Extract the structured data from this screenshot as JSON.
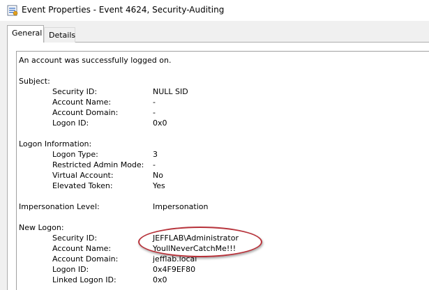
{
  "window": {
    "title": "Event Properties - Event 4624, Security-Auditing"
  },
  "tabs": [
    {
      "label": "General",
      "active": true
    },
    {
      "label": "Details",
      "active": false
    }
  ],
  "event": {
    "summary": "An account was successfully logged on.",
    "subject": {
      "heading": "Subject:",
      "security_id_label": "Security ID:",
      "security_id": "NULL SID",
      "account_name_label": "Account Name:",
      "account_name": "-",
      "account_domain_label": "Account Domain:",
      "account_domain": "-",
      "logon_id_label": "Logon ID:",
      "logon_id": "0x0"
    },
    "logon_information": {
      "heading": "Logon Information:",
      "logon_type_label": "Logon Type:",
      "logon_type": "3",
      "restricted_admin_label": "Restricted Admin Mode:",
      "restricted_admin": "-",
      "virtual_account_label": "Virtual Account:",
      "virtual_account": "No",
      "elevated_token_label": "Elevated Token:",
      "elevated_token": "Yes"
    },
    "impersonation": {
      "label": "Impersonation Level:",
      "value": "Impersonation"
    },
    "new_logon": {
      "heading": "New Logon:",
      "security_id_label": "Security ID:",
      "security_id": "JEFFLAB\\Administrator",
      "account_name_label": "Account Name:",
      "account_name": "YoullNeverCatchMe!!!",
      "account_domain_label": "Account Domain:",
      "account_domain": "jefflab.local",
      "logon_id_label": "Logon ID:",
      "logon_id": "0x4F9EF80",
      "linked_logon_id_label": "Linked Logon ID:",
      "linked_logon_id": "0x0"
    }
  },
  "colors": {
    "highlight": "#b7323a",
    "window_bg": "#f0f0f0",
    "panel_bg": "#ffffff"
  },
  "icons": {
    "app": "event-viewer-icon"
  }
}
